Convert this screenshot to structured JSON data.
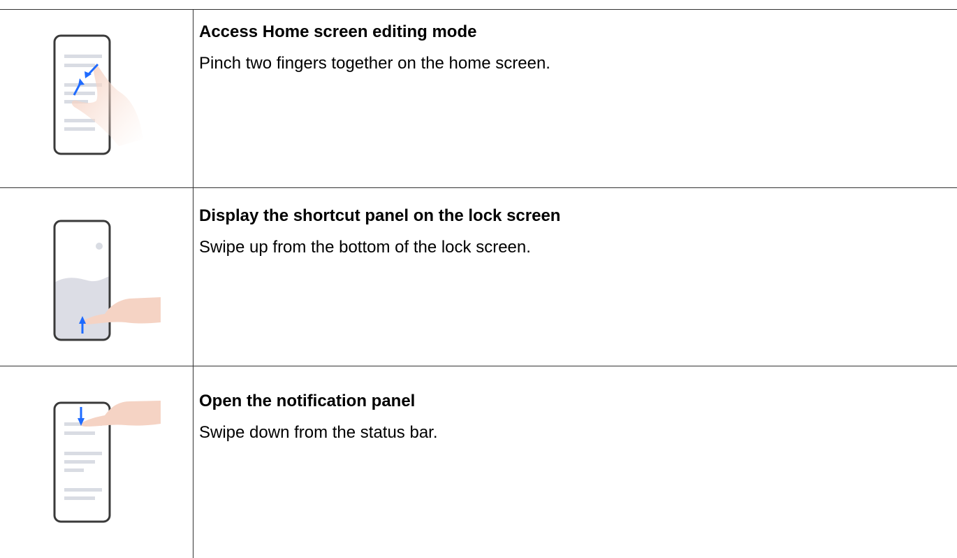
{
  "rows": [
    {
      "title": "Access Home screen editing mode",
      "description": "Pinch two fingers together on the home screen.",
      "icon": "pinch-gesture-icon"
    },
    {
      "title": "Display the shortcut panel on the lock screen",
      "description": "Swipe up from the bottom of the lock screen.",
      "icon": "swipe-up-gesture-icon"
    },
    {
      "title": "Open the notification panel",
      "description": "Swipe down from the status bar.",
      "icon": "swipe-down-gesture-icon"
    }
  ],
  "colors": {
    "rule": "#333333",
    "phone_outline": "#3a3a3a",
    "placeholder_line": "#d9dce3",
    "lock_wave": "#dcdde5",
    "hand": "#f5d3c4",
    "arrow": "#1f6bff"
  }
}
